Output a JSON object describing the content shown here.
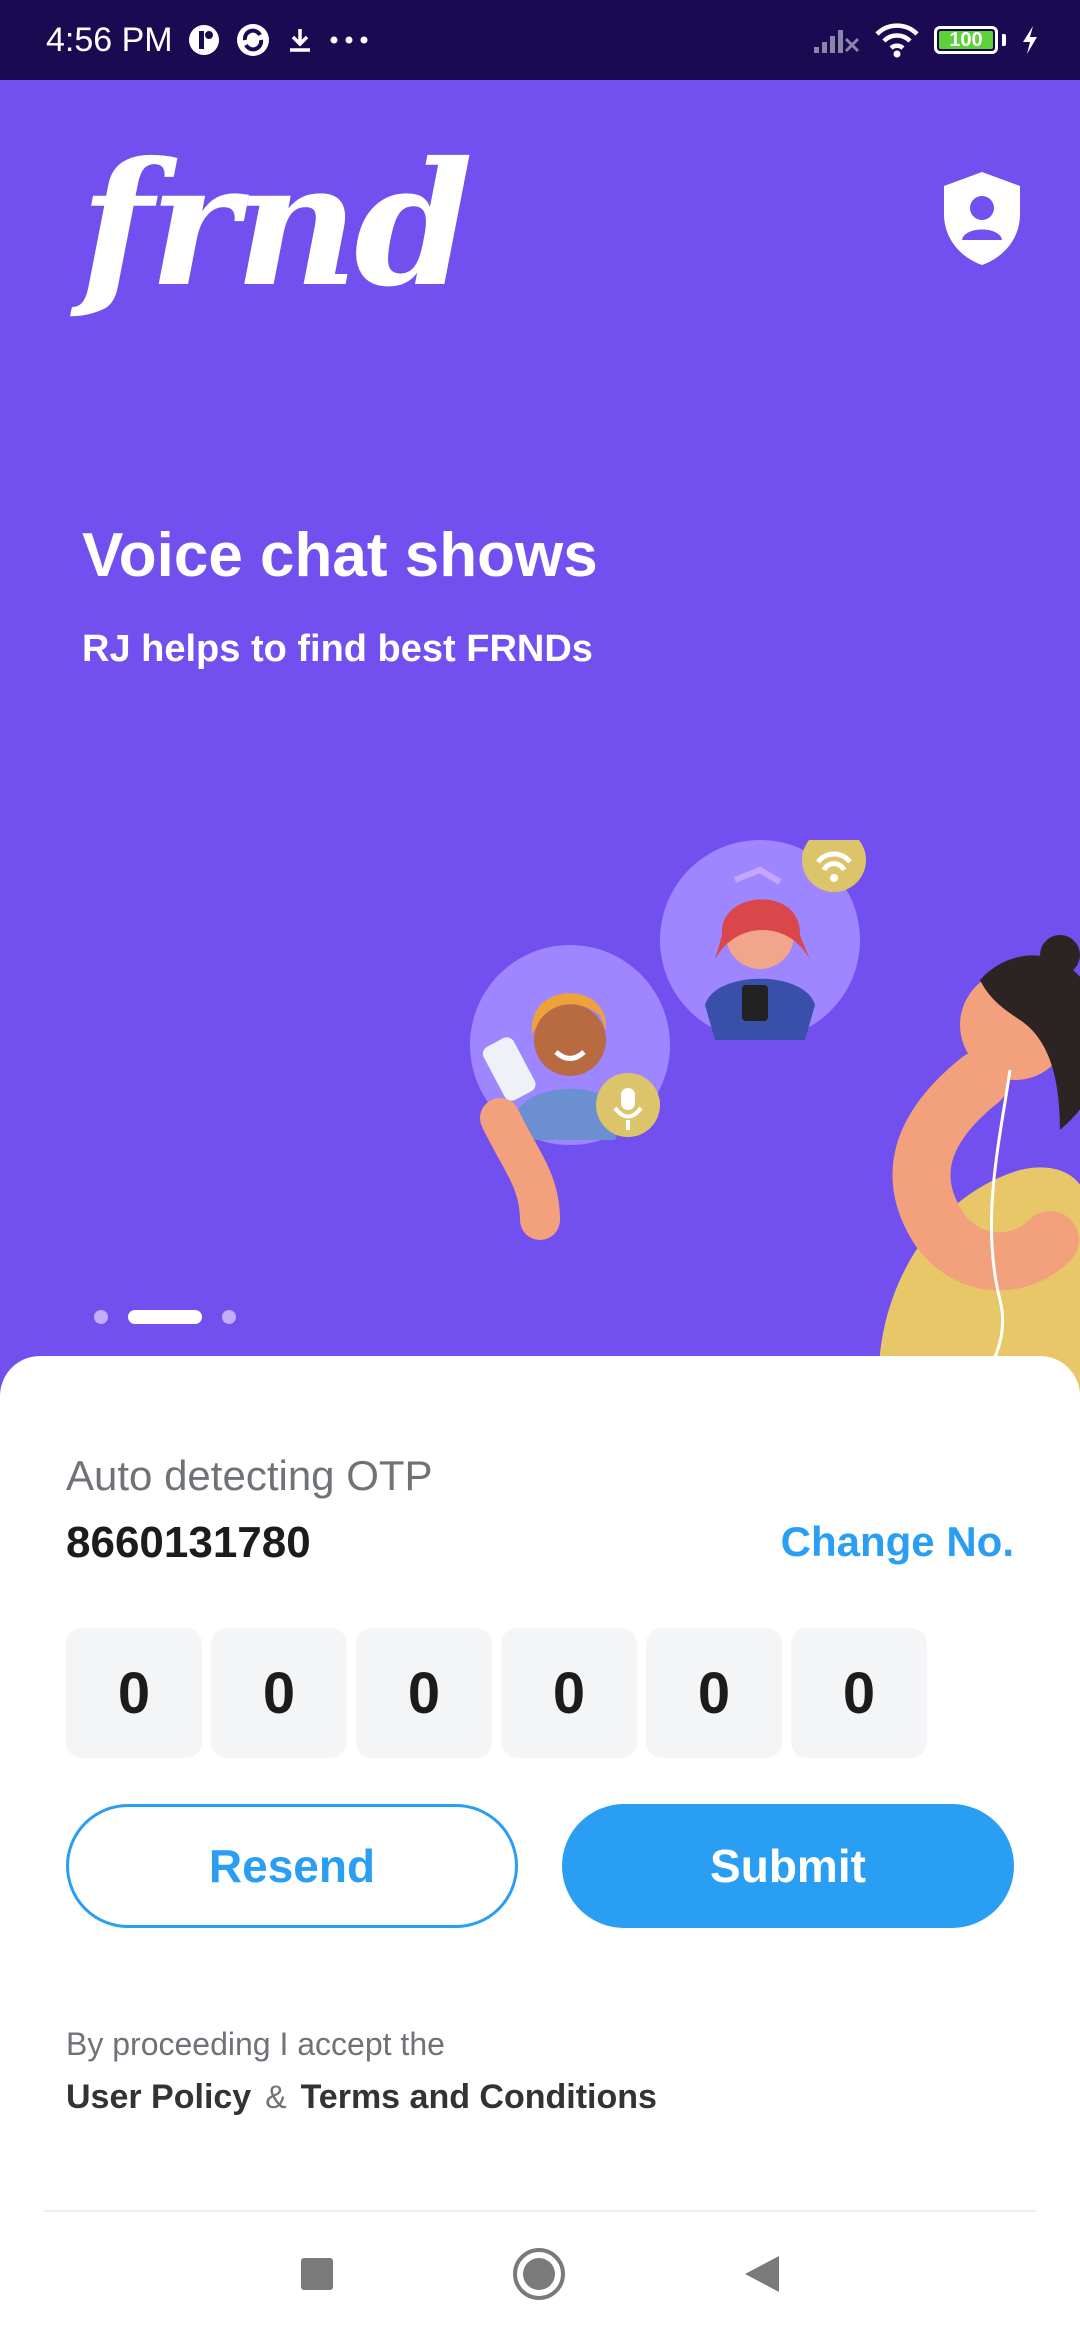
{
  "status_bar": {
    "time": "4:56 PM",
    "battery_level": 100,
    "battery_text": "100",
    "icons": [
      "notification-badge-icon",
      "sync-app-icon",
      "download-icon",
      "more-dots-icon",
      "signal-icon",
      "wifi-icon",
      "battery-icon",
      "charging-bolt-icon"
    ]
  },
  "hero": {
    "logo_text": "frnd",
    "title": "Voice chat shows",
    "subtitle": "RJ helps to find best FRNDs",
    "pager": {
      "count": 3,
      "active_index": 1
    }
  },
  "otp": {
    "auto_label": "Auto detecting OTP",
    "phone_number": "8660131780",
    "change_label": "Change No.",
    "digits": [
      "0",
      "0",
      "0",
      "0",
      "0",
      "0"
    ]
  },
  "actions": {
    "resend_label": "Resend",
    "submit_label": "Submit"
  },
  "legal": {
    "intro": "By proceeding I accept the",
    "user_policy": "User Policy",
    "amp": "&",
    "terms": "Terms and Conditions"
  },
  "colors": {
    "status_bar": "#1a0a52",
    "hero_bg": "#7150ef",
    "accent": "#2a9ef2",
    "otp_box": "#f4f5f7"
  },
  "nav_bar": {
    "buttons": [
      "recents-square-icon",
      "home-circle-icon",
      "back-triangle-icon"
    ]
  }
}
